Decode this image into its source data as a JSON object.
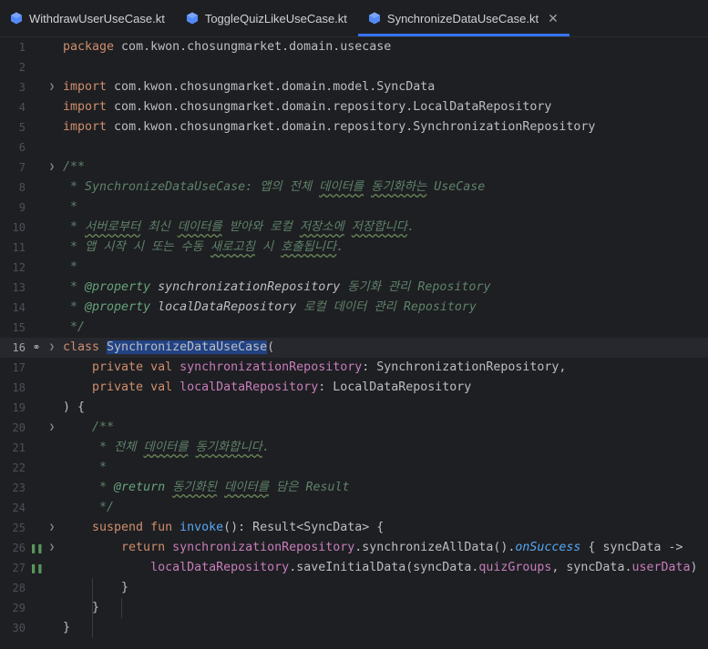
{
  "tabs": [
    {
      "label": "WithdrawUserUseCase.kt",
      "active": false
    },
    {
      "label": "ToggleQuizLikeUseCase.kt",
      "active": false
    },
    {
      "label": "SynchronizeDataUseCase.kt",
      "active": true
    }
  ],
  "icons": {
    "tab_file": "kotlin-class-icon",
    "close": "close-icon",
    "fold": "chevron-down-icon",
    "override": "override-icon",
    "run": "run-gutter-icon"
  },
  "colors": {
    "accent": "#3574f0",
    "keyword": "#cf8e6d",
    "function": "#56a8f5",
    "field": "#c77dbb",
    "doc": "#5f826b"
  },
  "code": {
    "l1_kw": "package",
    "l1_rest": " com.kwon.chosungmarket.domain.usecase",
    "l3_kw": "import",
    "l3_rest": " com.kwon.chosungmarket.domain.model.SyncData",
    "l4_kw": "import",
    "l4_rest": " com.kwon.chosungmarket.domain.repository.LocalDataRepository",
    "l5_kw": "import",
    "l5_rest": " com.kwon.chosungmarket.domain.repository.SynchronizationRepository",
    "l7": "/**",
    "l8_a": " * SynchronizeDataUseCase: ",
    "l8_b": "앱의",
    "l8_c": " 전체 ",
    "l8_d": "데이터를",
    "l8_e": " ",
    "l8_f": "동기화하는",
    "l8_g": " UseCase",
    "l9": " *",
    "l10_a": " * ",
    "l10_b": "서버로부터",
    "l10_c": " 최신 ",
    "l10_d": "데이터를",
    "l10_e": " 받아와 로컬 ",
    "l10_f": "저장소에",
    "l10_g": " ",
    "l10_h": "저장합니다",
    "l10_i": ".",
    "l11_a": " * 앱 시작 시 또는 수동 ",
    "l11_b": "새로고침",
    "l11_c": " 시 ",
    "l11_d": "호출됩니다",
    "l11_e": ".",
    "l12": " *",
    "l13_a": " * ",
    "l13_tag": "@property",
    "l13_b": " synchronizationRepository",
    "l13_c": " 동기화 관리 Repository",
    "l14_a": " * ",
    "l14_tag": "@property",
    "l14_b": " localDataRepository",
    "l14_c": " 로컬 데이터 관리 Repository",
    "l15": " */",
    "l16_kw": "class",
    "l16_sp": " ",
    "l16_name": "SynchronizeDataUseCase",
    "l16_rest": "(",
    "l17_kw": "    private val ",
    "l17_fld": "synchronizationRepository",
    "l17_rest": ": SynchronizationRepository,",
    "l18_kw": "    private val ",
    "l18_fld": "localDataRepository",
    "l18_rest": ": LocalDataRepository",
    "l19": ") {",
    "l20": "    /**",
    "l21_a": "     * 전체 ",
    "l21_b": "데이터를",
    "l21_c": " ",
    "l21_d": "동기화합니다",
    "l21_e": ".",
    "l22": "     *",
    "l23_a": "     * ",
    "l23_tag": "@return",
    "l23_b": " ",
    "l23_c": "동기화된",
    "l23_d": " ",
    "l23_e": "데이터를",
    "l23_f": " 담은 Result",
    "l24": "     */",
    "l25_kw": "    suspend fun ",
    "l25_fn": "invoke",
    "l25_rest": "(): Result<SyncData> {",
    "l26_kw": "        return ",
    "l26_fld": "synchronizationRepository",
    "l26_b": ".synchronizeAllData().",
    "l26_ext": "onSuccess",
    "l26_c": " { syncData ->",
    "l27_sp": "            ",
    "l27_fld": "localDataRepository",
    "l27_b": ".saveInitialData(syncData.",
    "l27_f1": "quizGroups",
    "l27_c": ", syncData.",
    "l27_f2": "userData",
    "l27_d": ")",
    "l28": "        }",
    "l29": "    }",
    "l30": "}"
  },
  "line_numbers": [
    "1",
    "2",
    "3",
    "4",
    "5",
    "6",
    "7",
    "8",
    "9",
    "10",
    "11",
    "12",
    "13",
    "14",
    "15",
    "16",
    "17",
    "18",
    "19",
    "20",
    "21",
    "22",
    "23",
    "24",
    "25",
    "26",
    "27",
    "28",
    "29",
    "30"
  ]
}
